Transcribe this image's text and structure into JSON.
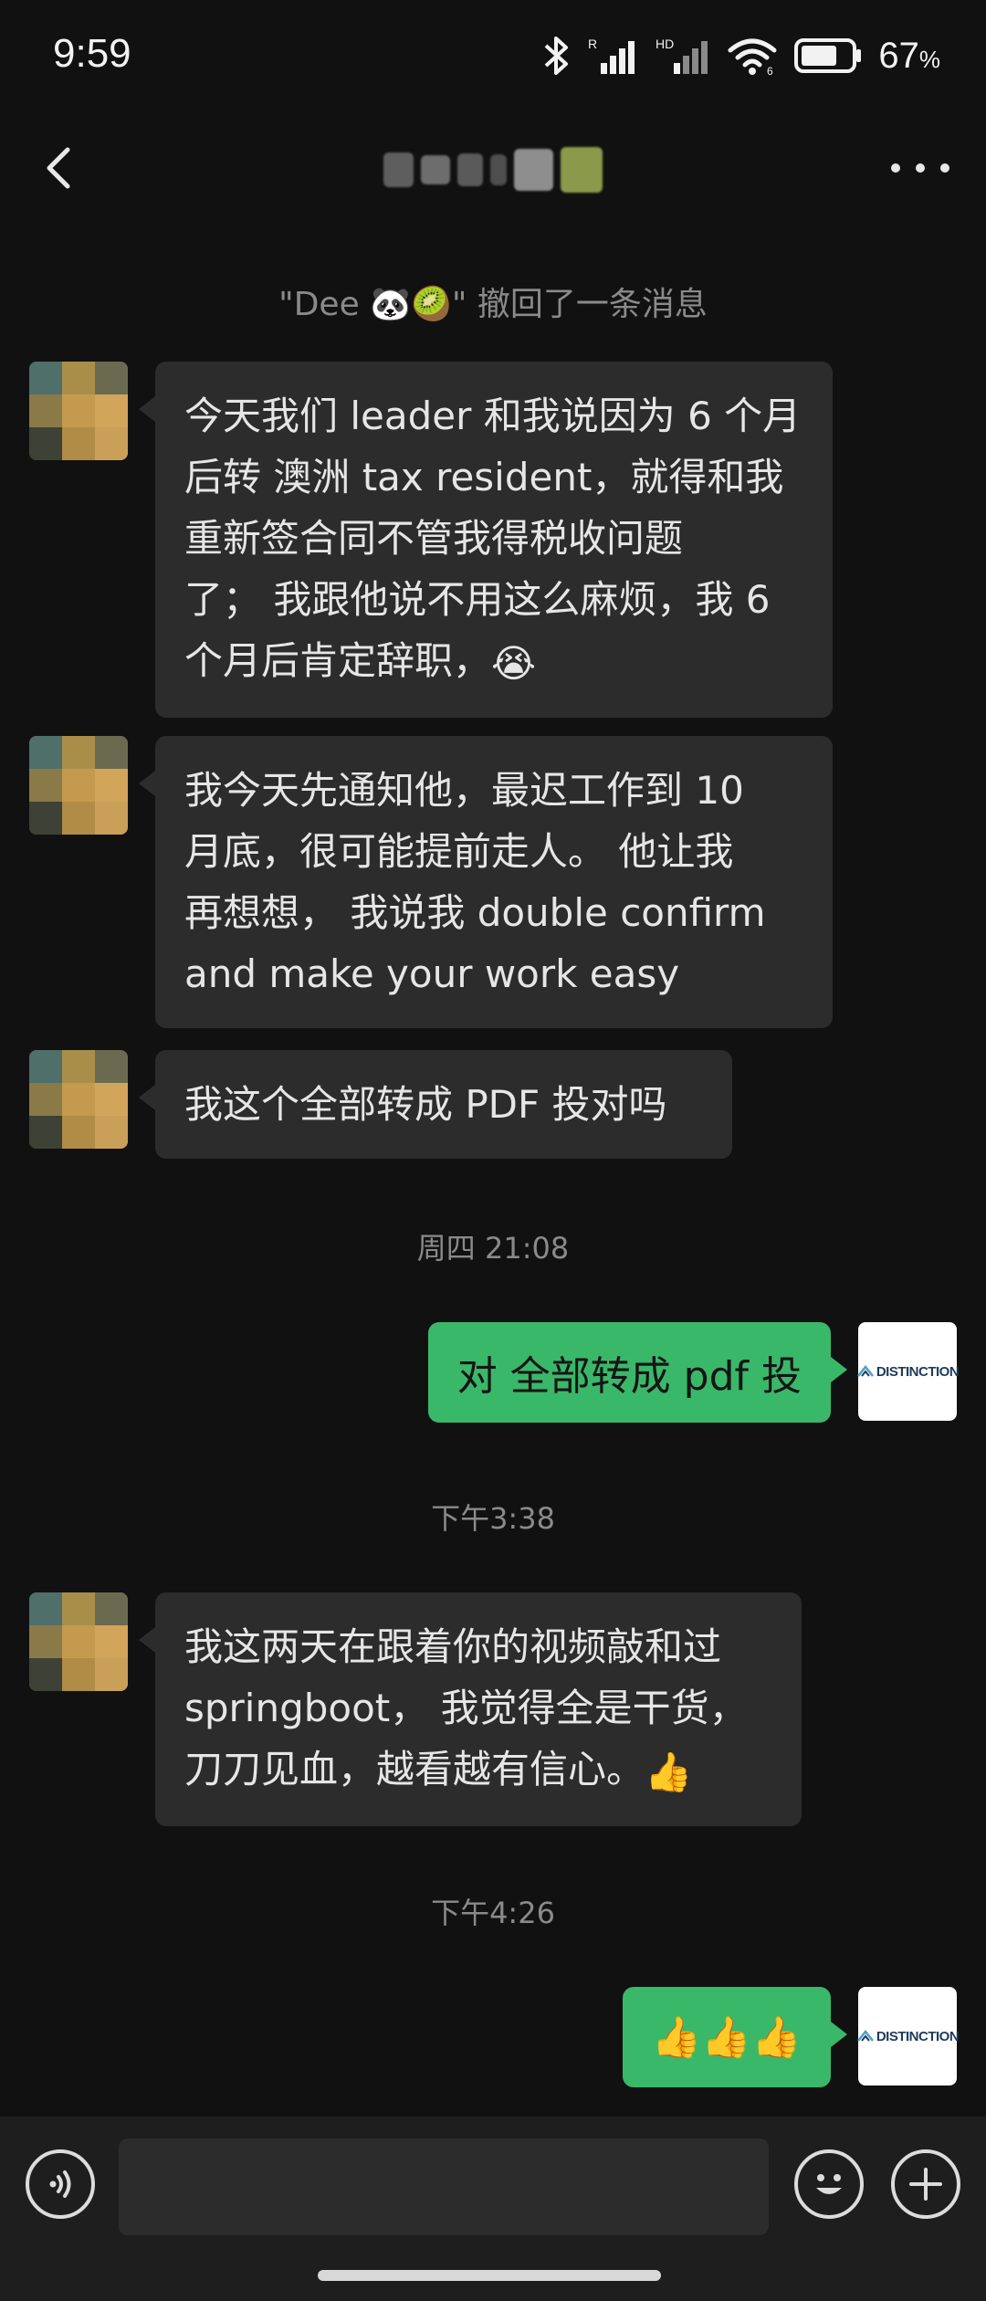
{
  "status": {
    "time": "9:59",
    "battery": "67",
    "battery_unit": "%"
  },
  "header": {
    "back_icon": "chevron-left-icon",
    "more_icon": "more-dots-icon"
  },
  "recall_notice": "\"Dee 🐼🥝\" 撤回了一条消息",
  "messages": {
    "m1": [
      "今天我们 leader 和我说因为 6 个月",
      "后转 澳洲 tax resident，就得和我",
      "重新签合同不管我得税收问题",
      "了；  我跟他说不用这么麻烦，我 6",
      "个月后肯定辞职，"
    ],
    "m1_emoji": "😭",
    "m2": [
      "我今天先通知他，最迟工作到 10",
      "月底，很可能提前走人。 他让我",
      "再想想， 我说我 double confirm",
      "and make your work easy"
    ],
    "m3": "我这个全部转成 PDF 投对吗",
    "ts1": "周四 21:08",
    "m4": "对  全部转成 pdf 投",
    "ts2": "下午3:38",
    "m5": [
      "我这两天在跟着你的视频敲和过",
      "springboot， 我觉得全是干货，",
      "刀刀见血，越看越有信心。"
    ],
    "m5_emoji": "👍",
    "ts3": "下午4:26",
    "m6": "👍👍👍"
  },
  "avatar_logo_text": "DISTINCTION",
  "input": {
    "placeholder": ""
  },
  "colors": {
    "background": "#111111",
    "incoming_bubble": "#2c2c2c",
    "outgoing_bubble": "#3ab869",
    "input_bar": "#1e1e1e"
  }
}
